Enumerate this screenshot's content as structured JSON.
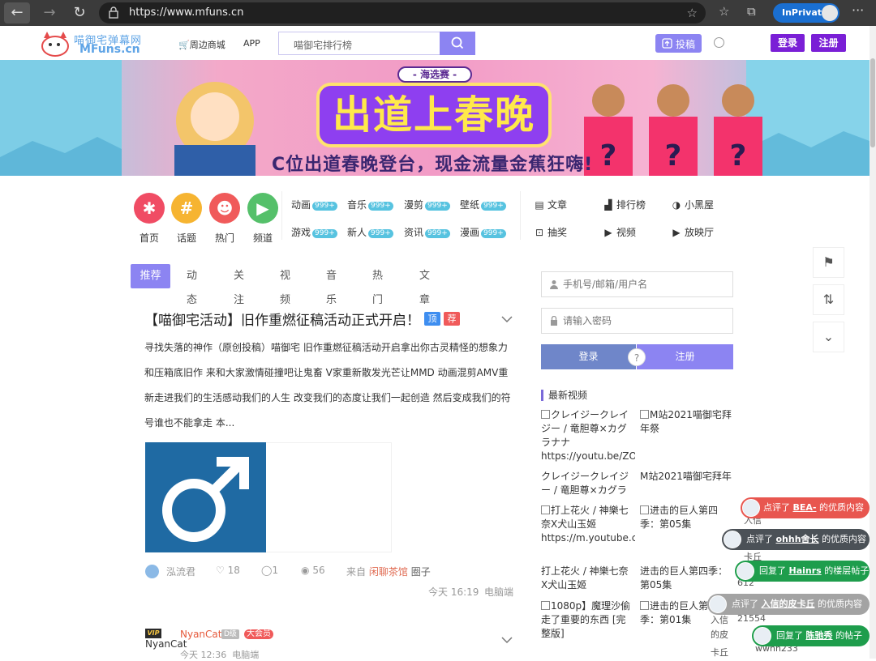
{
  "browser": {
    "url": "https://www.mfuns.cn",
    "inprivate_label": "InPrivate",
    "back_icon": "←",
    "forward_icon": "→",
    "reload_icon": "↻",
    "more_icon": "···"
  },
  "header": {
    "logo_cn": "喵御宅弹幕网",
    "logo_en": "MFuns.cn",
    "links": [
      "周边商城",
      "APP"
    ],
    "search_placeholder": "喵御宅排行榜",
    "upload_label": "投稿",
    "login_label": "登录",
    "register_label": "注册"
  },
  "banner": {
    "subtitle": "- 海选赛 -",
    "title": "出道上春晚",
    "caption": "C位出道春晚登台，现金流量金蕉狂嗨!"
  },
  "quick_nav": [
    {
      "label": "首页",
      "glyph": "✱",
      "color": "#f04c64"
    },
    {
      "label": "话题",
      "glyph": "#",
      "color": "#f6b431"
    },
    {
      "label": "热门",
      "glyph": "☻",
      "color": "#f05a5a"
    },
    {
      "label": "频道",
      "glyph": "▶",
      "color": "#55c06a"
    }
  ],
  "categories": [
    {
      "label": "动画",
      "badge": "999+"
    },
    {
      "label": "音乐",
      "badge": "999+"
    },
    {
      "label": "漫剪",
      "badge": "999+"
    },
    {
      "label": "壁纸",
      "badge": "999+"
    },
    {
      "label": "游戏",
      "badge": "999+"
    },
    {
      "label": "新人",
      "badge": "999+"
    },
    {
      "label": "资讯",
      "badge": "999+"
    },
    {
      "label": "漫画",
      "badge": "999+"
    }
  ],
  "sections": [
    {
      "label": "文章",
      "glyph": "▤"
    },
    {
      "label": "排行榜",
      "glyph": "▟"
    },
    {
      "label": "小黑屋",
      "glyph": "◑"
    },
    {
      "label": "抽奖",
      "glyph": "⊡"
    },
    {
      "label": "视频",
      "glyph": "▶"
    },
    {
      "label": "放映厅",
      "glyph": "▶"
    }
  ],
  "tabs": [
    "推荐",
    "动态",
    "关注",
    "视频",
    "音乐",
    "热门",
    "文章"
  ],
  "post": {
    "title": "【喵御宅活动】旧作重燃征稿活动正式开启！",
    "tag_top": "顶",
    "tag_rec": "荐",
    "body": "寻找失落的神作（原创投稿）喵御宅 旧作重燃征稿活动开启拿出你古灵精怪的想象力和压箱底旧作 来和大家激情碰撞吧让鬼畜 V家重新散发光芒让MMD 动画混剪AMV重新走进我们的生活感动我们的人生 改变我们的态度让我们一起创造 然后变成我们的符号谁也不能拿走 本...",
    "author": "泓流君",
    "likes": "18",
    "comments": "1",
    "views": "56",
    "from_label": "来自",
    "source": "闲聊茶馆",
    "circle_label": "圈子",
    "time": "今天 16:19",
    "device": "电脑端"
  },
  "next_post": {
    "vip_badge": "VIP",
    "name": "NyanCat",
    "alt_name": "NyanCat",
    "level": "D级",
    "member": "大会员",
    "time": "今天 12:36",
    "device": "电脑端"
  },
  "sidebar": {
    "account_placeholder": "手机号/邮箱/用户名",
    "password_placeholder": "请输入密码",
    "login_label": "登录",
    "register_label": "注册",
    "help_label": "?",
    "latest_title": "最新视频",
    "videos": [
      {
        "text": "クレイジークレイジー / 竜胆尊×カグラナナ https://youtu.be/ZO...",
        "broken": true
      },
      {
        "text": "M站2021喵御宅拜年祭",
        "broken": true
      },
      {
        "text": "クレイジークレイジー / 竜胆尊×カグラナ...",
        "broken": false
      },
      {
        "text": "M站2021喵御宅拜年祭",
        "broken": false
      },
      {
        "text": "打上花火 / 神樂七奈X犬山玉姬 https://m.youtube.com/feature=youtu.be&v...",
        "broken": true
      },
      {
        "text": "进击的巨人第四季：第05集",
        "broken": true
      },
      {
        "text": "打上花火 / 神樂七奈X犬山玉姬 https://m.y...",
        "broken": false
      },
      {
        "text": "进击的巨人第四季：第05集",
        "broken": false
      },
      {
        "text": "1080p】魔理沙偷走了重要的东西 [完整版]",
        "broken": true
      },
      {
        "text": "进击的巨人第四季：第01集",
        "broken": true
      }
    ]
  },
  "right_tools": [
    "⚑",
    "⇅",
    "⌄"
  ],
  "activity": [
    {
      "action": "点评了",
      "user": "BEA-",
      "suffix": "的优质内容",
      "color": "#e8564f"
    },
    {
      "action": "点评了",
      "user": "ohhh舍长",
      "suffix": "的优质内容",
      "color": "#4b5157"
    },
    {
      "action": "回复了",
      "user": "Hainrs",
      "suffix": "的楼层帖子",
      "color": "#1e9d4c"
    },
    {
      "action": "点评了",
      "user": "入信的皮卡丘",
      "suffix": "的优质内容",
      "color": "#9e9e9e"
    },
    {
      "action": "回复了",
      "user": "陈驰秀",
      "suffix": "的帖子",
      "color": "#1e9d4c"
    }
  ],
  "ghost_text": [
    "入信",
    "卡丘",
    "612",
    "21554",
    "入信",
    "的皮",
    "卡丘",
    "wwhh233"
  ]
}
